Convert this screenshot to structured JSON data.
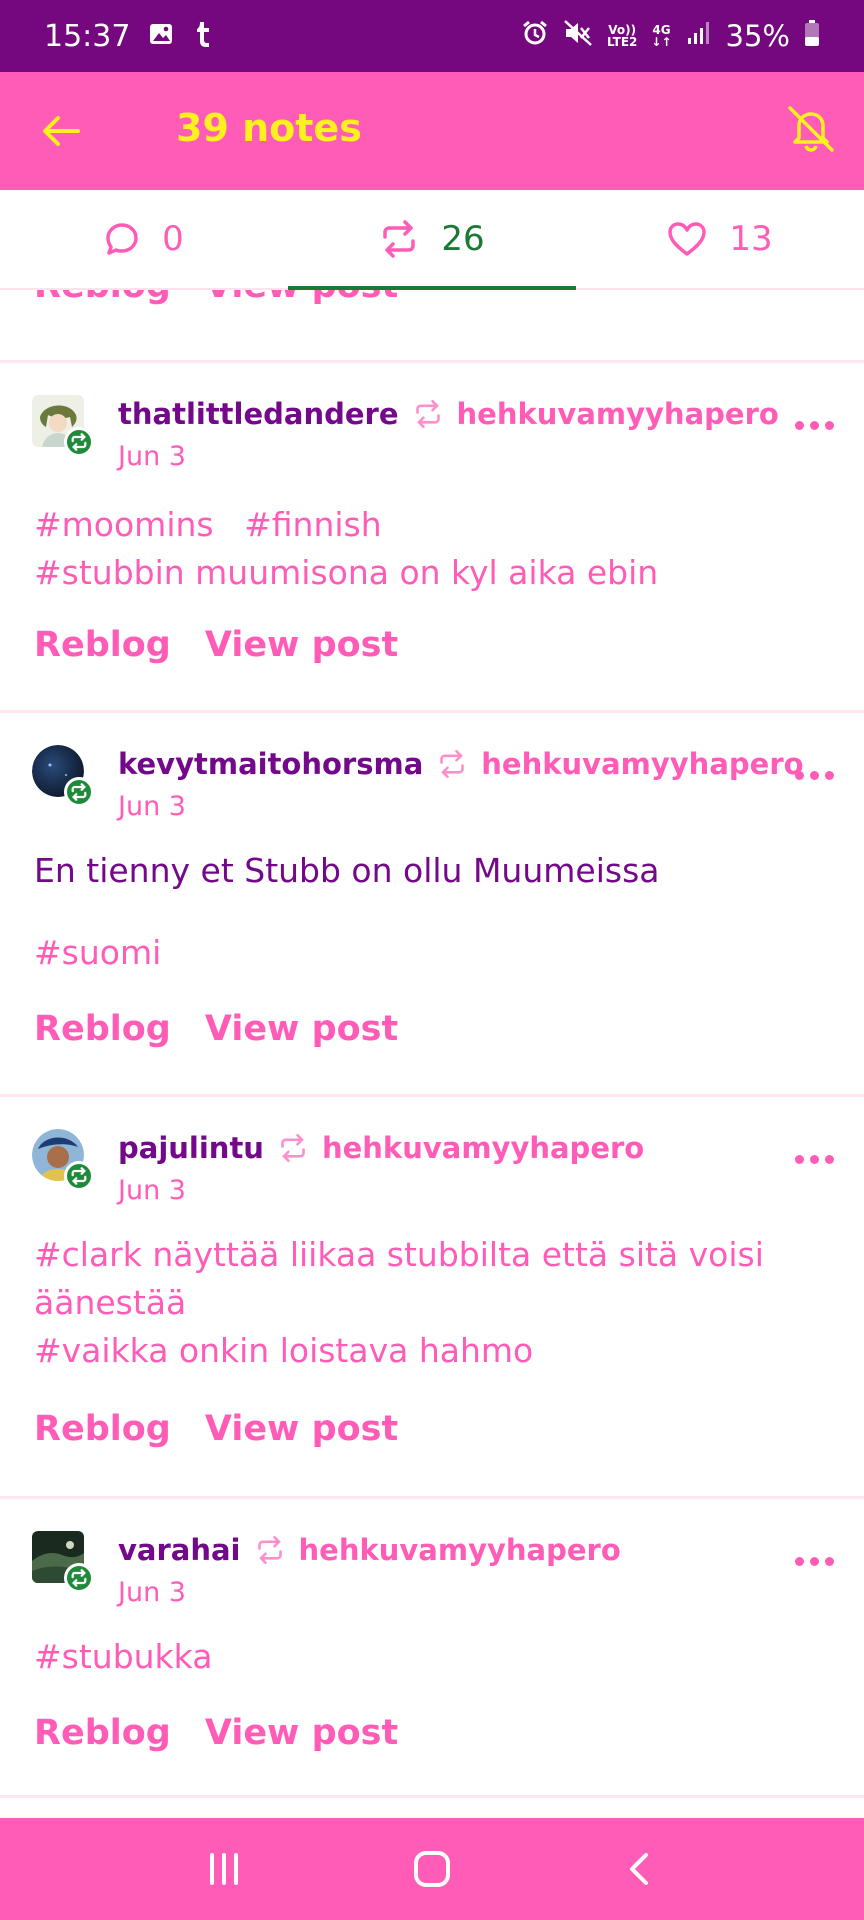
{
  "status_bar": {
    "time": "15:37",
    "left_icons": [
      "image-icon",
      "tumblr-icon"
    ],
    "volte_top": "Vo))",
    "volte_bottom": "LTE2",
    "network_type": "4G",
    "battery_percent": "35%",
    "battery_level": 0.35
  },
  "app_bar": {
    "title": "39 notes",
    "back_icon": "arrow-left-icon",
    "bell_icon": "bell-off-icon"
  },
  "tabs": [
    {
      "icon": "comment-icon",
      "count": "0"
    },
    {
      "icon": "reblog-icon",
      "count": "26",
      "active": true
    },
    {
      "icon": "heart-icon",
      "count": "13"
    }
  ],
  "actions": {
    "reblog": "Reblog",
    "view_post": "View post"
  },
  "posts": [
    {
      "author": "thatlittledandere",
      "reblogged_from": "hehkuvamyyhapero",
      "date": "Jun 3",
      "body": "",
      "tags": [
        "#moomins",
        "#finnish",
        "#stubbin muumisona on kyl aika ebin"
      ]
    },
    {
      "author": "kevytmaitohorsma",
      "reblogged_from": "hehkuvamyyhapero",
      "date": "Jun 3",
      "body": "En tienny et Stubb on ollu Muumeissa",
      "tags": [
        "#suomi"
      ]
    },
    {
      "author": "pajulintu",
      "reblogged_from": "hehkuvamyyhapero",
      "date": "Jun 3",
      "body": "",
      "tags": [
        "#clark näyttää liikaa stubbilta että sitä voisi äänestää",
        "#vaikka onkin loistava hahmo"
      ]
    },
    {
      "author": "varahai",
      "reblogged_from": "hehkuvamyyhapero",
      "date": "Jun 3",
      "body": "",
      "tags": [
        "#stubukka"
      ]
    }
  ],
  "colors": {
    "status_bar": "#75087f",
    "accent_pink": "#ff5cb8",
    "title_yellow": "#fff01f",
    "text_purple": "#74088a",
    "active_green": "#1a7a34"
  },
  "nav_bar": {
    "buttons": [
      "recents-icon",
      "home-icon",
      "back-icon"
    ]
  }
}
